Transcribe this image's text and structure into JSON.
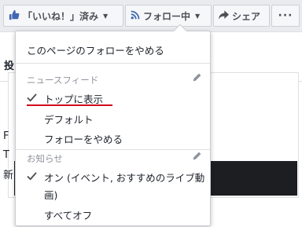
{
  "action_bar": {
    "like_label": "「いいね！」済み",
    "follow_label": "フォロー中",
    "share_label": "シェア",
    "more_label": "···"
  },
  "background": {
    "heading_fragment": "投",
    "fragment_1": "F",
    "fragment_2": "T",
    "fragment_3": "新"
  },
  "menu": {
    "unfollow_page": "このページのフォローをやめる",
    "news_feed_section": "ニュースフィード",
    "feed_options": [
      {
        "label": "トップに表示",
        "checked": true
      },
      {
        "label": "デフォルト",
        "checked": false
      },
      {
        "label": "フォローをやめる",
        "checked": false
      }
    ],
    "notifications_section": "お知らせ",
    "notification_options": [
      {
        "label_line1": "オン (イベント, おすすめのライブ動",
        "label_line2": "画)",
        "checked": true
      },
      {
        "label_line1": "すべてオフ",
        "checked": false
      }
    ]
  },
  "colors": {
    "facebook_blue": "#4267b2",
    "annotation_red": "#d0021b",
    "menu_text": "#1d2129",
    "section_gray": "#90949c"
  },
  "icons": [
    "thumbs-up-icon",
    "rss-icon",
    "share-arrow-icon",
    "chevron-down-icon",
    "checkmark-icon",
    "pencil-icon"
  ]
}
